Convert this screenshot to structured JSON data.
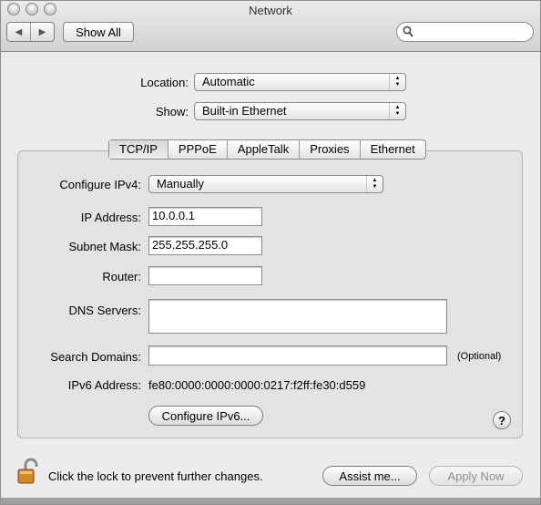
{
  "window": {
    "title": "Network"
  },
  "toolbar": {
    "show_all_label": "Show All",
    "back_icon": "◀",
    "forward_icon": "▶",
    "search_placeholder": ""
  },
  "location": {
    "label": "Location:",
    "value": "Automatic"
  },
  "show": {
    "label": "Show:",
    "value": "Built-in Ethernet"
  },
  "tabs": [
    {
      "label": "TCP/IP",
      "selected": true
    },
    {
      "label": "PPPoE",
      "selected": false
    },
    {
      "label": "AppleTalk",
      "selected": false
    },
    {
      "label": "Proxies",
      "selected": false
    },
    {
      "label": "Ethernet",
      "selected": false
    }
  ],
  "form": {
    "configure_ipv4_label": "Configure IPv4:",
    "configure_ipv4_value": "Manually",
    "ip_address_label": "IP Address:",
    "ip_address_value": "10.0.0.1",
    "subnet_mask_label": "Subnet Mask:",
    "subnet_mask_value": "255.255.255.0",
    "router_label": "Router:",
    "router_value": "",
    "dns_label": "DNS Servers:",
    "dns_value": "",
    "search_domains_label": "Search Domains:",
    "search_domains_value": "",
    "optional_label": "(Optional)",
    "ipv6_label": "IPv6 Address:",
    "ipv6_value": "fe80:0000:0000:0000:0217:f2ff:fe30:d559",
    "configure_ipv6_label": "Configure IPv6..."
  },
  "footer": {
    "lock_message": "Click the lock to prevent further changes.",
    "assist_label": "Assist me...",
    "apply_label": "Apply Now",
    "help_label": "?"
  }
}
